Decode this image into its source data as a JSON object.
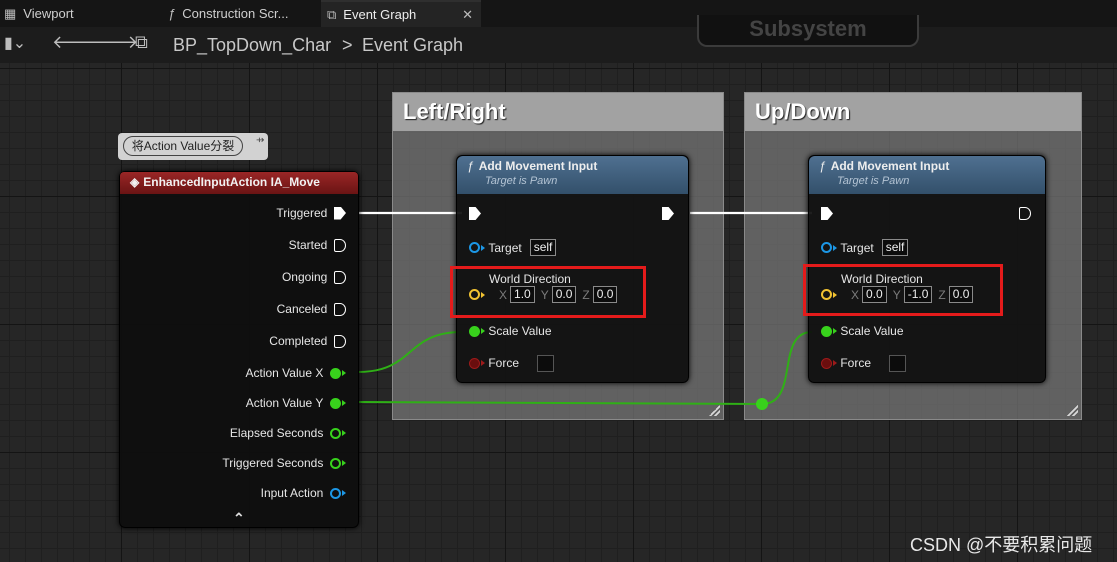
{
  "tabs": [
    {
      "label": "Viewport",
      "icon": "viewport-icon"
    },
    {
      "label": "Construction Scr...",
      "icon": "function-icon"
    },
    {
      "label": "Event Graph",
      "icon": "graph-icon",
      "close": "✕"
    }
  ],
  "breadcrumb": {
    "blueprint": "BP_TopDown_Char",
    "separator": ">",
    "graph": "Event Graph"
  },
  "background_node": {
    "label": "Subsystem"
  },
  "comments": [
    {
      "title": "Left/Right"
    },
    {
      "title": "Up/Down"
    }
  ],
  "event_node": {
    "tooltip": "将Action Value分裂",
    "title": "EnhancedInputAction IA_Move",
    "pins": [
      {
        "label": "Triggered",
        "type": "exec"
      },
      {
        "label": "Started",
        "type": "exec"
      },
      {
        "label": "Ongoing",
        "type": "exec"
      },
      {
        "label": "Canceled",
        "type": "exec"
      },
      {
        "label": "Completed",
        "type": "exec"
      },
      {
        "label": "Action Value X",
        "type": "float"
      },
      {
        "label": "Action Value Y",
        "type": "float"
      },
      {
        "label": "Elapsed Seconds",
        "type": "float"
      },
      {
        "label": "Triggered Seconds",
        "type": "float"
      },
      {
        "label": "Input Action",
        "type": "object"
      }
    ],
    "collapse": "⌃"
  },
  "move_nodes": [
    {
      "title": "Add Movement Input",
      "subtitle": "Target is Pawn",
      "target_label": "Target",
      "target_value": "self",
      "direction_label": "World Direction",
      "x_label": "X",
      "x": "1.0",
      "y_label": "Y",
      "y": "0.0",
      "z_label": "Z",
      "z": "0.0",
      "scale_label": "Scale Value",
      "force_label": "Force"
    },
    {
      "title": "Add Movement Input",
      "subtitle": "Target is Pawn",
      "target_label": "Target",
      "target_value": "self",
      "direction_label": "World Direction",
      "x_label": "X",
      "x": "0.0",
      "y_label": "Y",
      "y": "-1.0",
      "z_label": "Z",
      "z": "0.0",
      "scale_label": "Scale Value",
      "force_label": "Force"
    }
  ],
  "watermark": "CSDN @不要积累问题",
  "colors": {
    "exec": "#ffffff",
    "float": "#38d21c",
    "object": "#1c97e6",
    "vector": "#f1c232",
    "highlight": "#e41b1b",
    "event_header": "#9a2626",
    "function_header": "#4f7091"
  }
}
